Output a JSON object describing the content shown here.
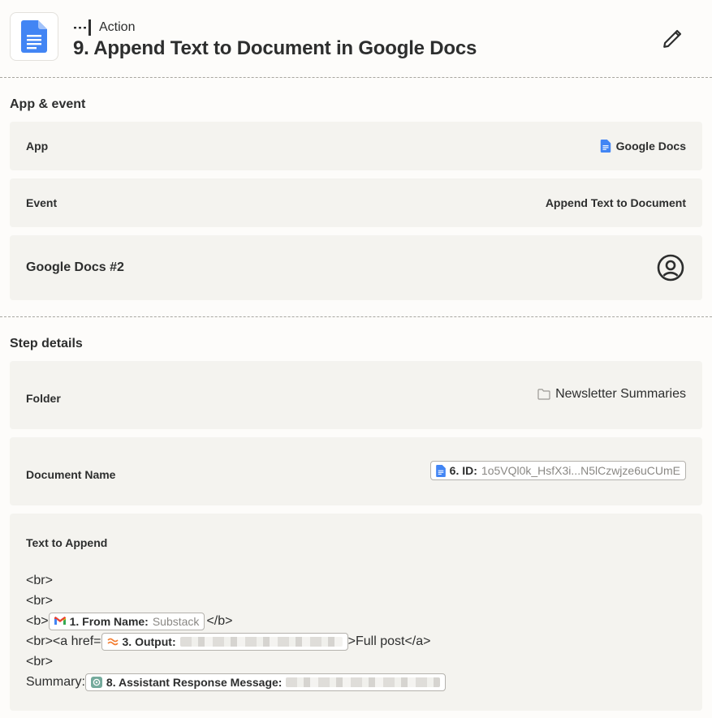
{
  "header": {
    "kind_label": "Action",
    "title": "9. Append Text to Document in Google Docs"
  },
  "app_event": {
    "section_title": "App & event",
    "app_label": "App",
    "app_value": "Google Docs",
    "event_label": "Event",
    "event_value": "Append Text to Document",
    "account_label": "Google Docs #2"
  },
  "step_details": {
    "section_title": "Step details",
    "folder_label": "Folder",
    "folder_value": "Newsletter Summaries",
    "doc_name_label": "Document Name",
    "doc_name_pill_key": "6. ID:",
    "doc_name_pill_val": "1o5VQl0k_HsfX3i...N5lCzwjze6uCUmE",
    "text_label": "Text to Append",
    "lines": {
      "l1": "<br>",
      "l2": "<br>",
      "l3_pre": "<b>",
      "l3_pill_key": "1. From Name:",
      "l3_pill_val": "Substack",
      "l3_post": "</b>",
      "l4_pre": "<br><a href=",
      "l4_pill_key": "3. Output:",
      "l4_post": ">Full post</a>",
      "l5": "<br>",
      "l6_pre": "Summary:",
      "l6_pill_key": "8. Assistant Response Message:"
    }
  },
  "colors": {
    "background": "#fdfcfa",
    "card": "#f4f3ef",
    "text": "#2d2e2e",
    "google_docs_blue": "#4285f4",
    "gmail_red": "#ea4335",
    "openai_green": "#74aa9c"
  },
  "icons": {
    "app": "google-docs-icon",
    "kind": "action-step-icon",
    "edit": "pencil-icon",
    "account": "user-circle-icon",
    "folder": "folder-icon"
  }
}
